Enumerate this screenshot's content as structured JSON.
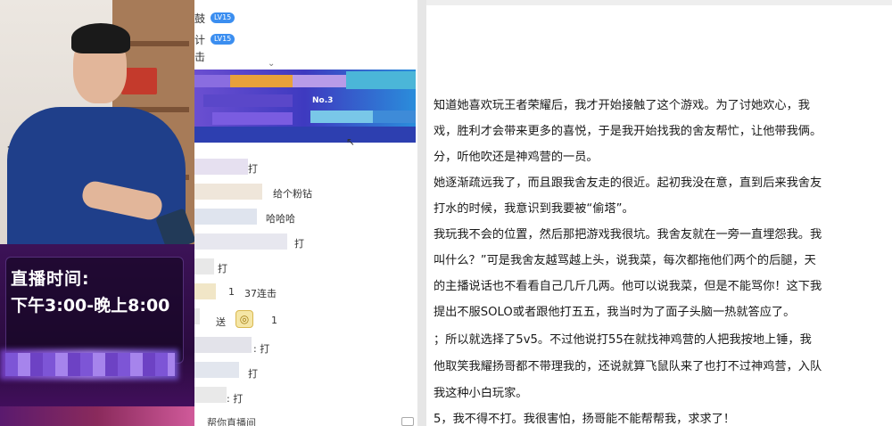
{
  "webcam": {
    "overlay_title": "直播时间:",
    "overlay_hours": "下午3:00-晚上8:00"
  },
  "chat": {
    "top_users": [
      {
        "name_fragment": "鼓",
        "badge": "LV15"
      },
      {
        "name_fragment": "计",
        "badge": "LV15"
      },
      {
        "name_fragment": "击",
        "badge": ""
      }
    ],
    "banner_text": "No.3",
    "messages": [
      {
        "text": "打"
      },
      {
        "text": "给个粉钻"
      },
      {
        "text": "哈哈哈"
      },
      {
        "text": "打"
      },
      {
        "text": "打"
      },
      {
        "text": "1"
      },
      {
        "text": "37连击"
      },
      {
        "text": "送"
      },
      {
        "text": "1"
      },
      {
        "text": ": 打"
      },
      {
        "text": "打"
      },
      {
        "text": ": 打"
      }
    ],
    "footer_text": "帮你直播间"
  },
  "document": {
    "lines": [
      "知道她喜欢玩王者荣耀后，我才开始接触了这个游戏。为了讨她欢心，我",
      "戏，胜利才会带来更多的喜悦，于是我开始找我的舍友帮忙，让他带我俩。",
      "分，听他吹还是神鸡营的一员。",
      "她逐渐疏远我了，而且跟我舍友走的很近。起初我没在意，直到后来我舍友",
      "打水的时候，我意识到我要被“偷塔”。",
      "我玩我不会的位置，然后那把游戏我很坑。我舍友就在一旁一直埋怨我。我",
      "叫什么？”可是我舍友越骂越上头，说我菜，每次都拖他们两个的后腿，天",
      "的主播说话也不看看自己几斤几两。他可以说我菜，但是不能骂你！这下我",
      "提出不服SOLO或者跟他打五五，我当时为了面子头脑一热就答应了。",
      "；所以就选择了5v5。不过他说打55在就找神鸡营的人把我按地上锤，我",
      "他取笑我耀扬哥都不带理我的，还说就算飞鼠队来了也打不过神鸡营，入队",
      "我这种小白玩家。",
      "5，我不得不打。我很害怕，扬哥能不能帮帮我，求求了！"
    ]
  }
}
